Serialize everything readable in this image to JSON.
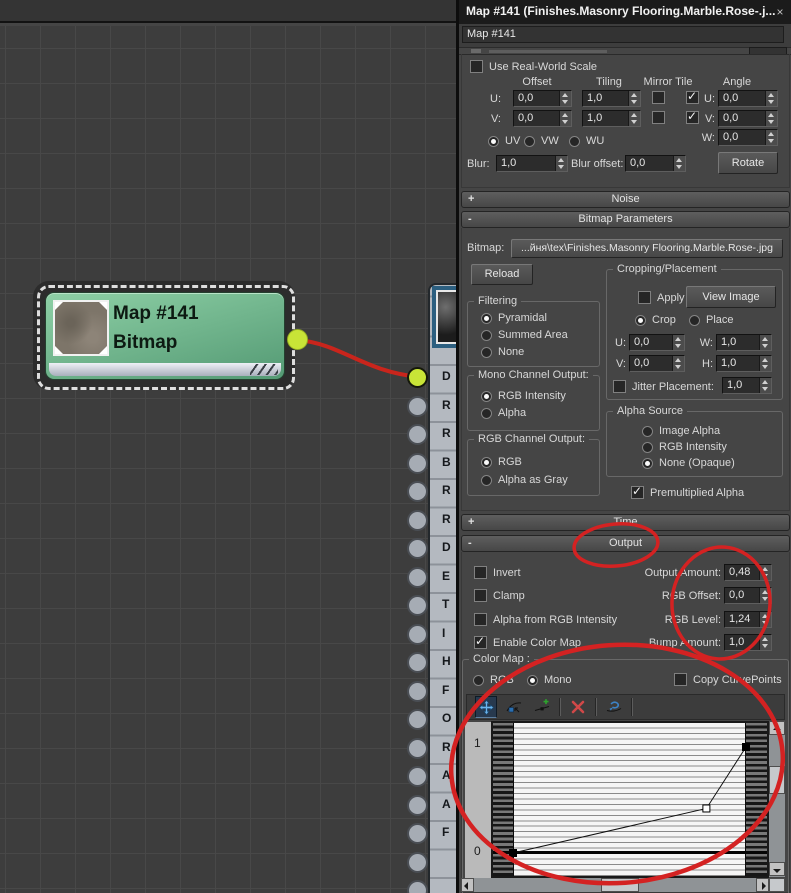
{
  "titlebar": {
    "title": "Map #141 (Finishes.Masonry Flooring.Marble.Rose-.j...",
    "close_glyph": "×"
  },
  "name_field": {
    "value": "Map #141"
  },
  "nodeview": {
    "bitmap_node": {
      "title": "Map #141",
      "subtitle": "Bitmap"
    },
    "target_node": {
      "sockets": [
        "D",
        "R",
        "R",
        "B",
        "R",
        "R",
        "D",
        "E",
        "T",
        "I",
        "H",
        "F",
        "O",
        "R",
        "A",
        "A",
        "F"
      ]
    }
  },
  "coordinates": {
    "use_real_world_scale": "Use Real-World Scale",
    "col_offset": "Offset",
    "col_tiling": "Tiling",
    "col_mirror_tile": "Mirror Tile",
    "col_angle": "Angle",
    "row_u_label": "U:",
    "row_v_label": "V:",
    "row_w_label": "W:",
    "offset_u": "0,0",
    "offset_v": "0,0",
    "tiling_u": "1,0",
    "tiling_v": "1,0",
    "angle_u": "0,0",
    "angle_v": "0,0",
    "angle_w": "0,0",
    "radio_uv": "UV",
    "radio_vw": "VW",
    "radio_wu": "WU",
    "blur_label": "Blur:",
    "blur_value": "1,0",
    "blur_offset_label": "Blur offset:",
    "blur_offset_value": "0,0",
    "rotate_button": "Rotate"
  },
  "rollouts": {
    "noise": {
      "state": "+",
      "label": "Noise"
    },
    "bitmap_parameters": {
      "state": "-",
      "label": "Bitmap Parameters"
    },
    "time": {
      "state": "+",
      "label": "Time"
    },
    "output": {
      "state": "-",
      "label": "Output"
    }
  },
  "bitmap_params": {
    "bitmap_label": "Bitmap:",
    "bitmap_path": "...йня\\tex\\Finishes.Masonry Flooring.Marble.Rose-.jpg",
    "reload_button": "Reload",
    "cropping": {
      "title": "Cropping/Placement",
      "apply": "Apply",
      "view_image": "View Image",
      "crop": "Crop",
      "place": "Place",
      "u_label": "U:",
      "u": "0,0",
      "v_label": "V:",
      "v": "0,0",
      "w_label": "W:",
      "w": "1,0",
      "h_label": "H:",
      "h": "1,0",
      "jitter_label": "Jitter Placement:",
      "jitter": "1,0"
    },
    "filtering": {
      "title": "Filtering",
      "pyramidal": "Pyramidal",
      "summed_area": "Summed Area",
      "none": "None"
    },
    "mono_channel": {
      "title": "Mono Channel Output:",
      "rgb_intensity": "RGB Intensity",
      "alpha": "Alpha"
    },
    "rgb_channel": {
      "title": "RGB Channel Output:",
      "rgb": "RGB",
      "alpha_as_gray": "Alpha as Gray"
    },
    "alpha_source": {
      "title": "Alpha Source",
      "image_alpha": "Image Alpha",
      "rgb_intensity": "RGB Intensity",
      "none_opaque": "None (Opaque)"
    },
    "premultiplied_alpha": "Premultiplied Alpha"
  },
  "output": {
    "invert": "Invert",
    "clamp": "Clamp",
    "alpha_from_rgb": "Alpha from RGB Intensity",
    "enable_color_map": "Enable Color Map",
    "output_amount_label": "Output Amount:",
    "output_amount": "0,48",
    "rgb_offset_label": "RGB Offset:",
    "rgb_offset": "0,0",
    "rgb_level_label": "RGB Level:",
    "rgb_level": "1,24",
    "bump_amount_label": "Bump Amount:",
    "bump_amount": "1,0",
    "color_map": {
      "title": "Color Map :",
      "radio_rgb": "RGB",
      "radio_mono": "Mono",
      "copy_curvepoints": "Copy CurvePoints",
      "axis_max": "1",
      "axis_min": "0",
      "curve_points": [
        {
          "x": 0.0,
          "y": 0.0,
          "style": "filled"
        },
        {
          "x": 0.83,
          "y": 0.42,
          "style": "open"
        },
        {
          "x": 1.0,
          "y": 1.0,
          "style": "filled"
        }
      ]
    }
  },
  "colors": {
    "node_green": "#5fa97c",
    "socket_yellow": "#c8e437",
    "wire_red": "#c9251c",
    "annotation_red": "#d42222",
    "panel_gray": "#454545",
    "accent_blue": "#4a90c4"
  }
}
